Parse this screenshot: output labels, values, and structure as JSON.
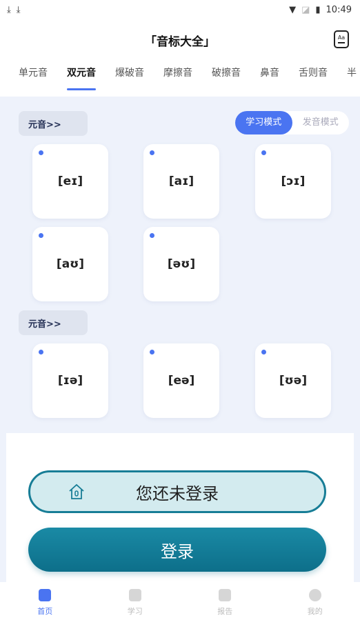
{
  "status_bar": {
    "time": "10:49"
  },
  "header": {
    "title": "「音标大全」",
    "font_icon_label": "Aa"
  },
  "tabs": [
    {
      "label": "单元音"
    },
    {
      "label": "双元音"
    },
    {
      "label": "爆破音"
    },
    {
      "label": "摩擦音"
    },
    {
      "label": "破擦音"
    },
    {
      "label": "鼻音"
    },
    {
      "label": "舌则音"
    },
    {
      "label": "半"
    }
  ],
  "mode_toggle": {
    "learn": "学习模式",
    "pronounce": "发音模式"
  },
  "sections": [
    {
      "tag": "元音>>",
      "symbols": [
        "[eɪ]",
        "[aɪ]",
        "[ɔɪ]",
        "[aʊ]",
        "[əʊ]"
      ]
    },
    {
      "tag": "元音>>",
      "symbols": [
        "[ɪə]",
        "[eə]",
        "[ʊə]"
      ]
    }
  ],
  "login": {
    "prompt": "您还未登录",
    "button": "登录"
  },
  "bottom_nav": [
    {
      "label": "首页"
    },
    {
      "label": "学习"
    },
    {
      "label": "报告"
    },
    {
      "label": "我的"
    }
  ],
  "colors": {
    "accent": "#4a74f1",
    "teal": "#177d96",
    "page_bg": "#eef2fb"
  }
}
